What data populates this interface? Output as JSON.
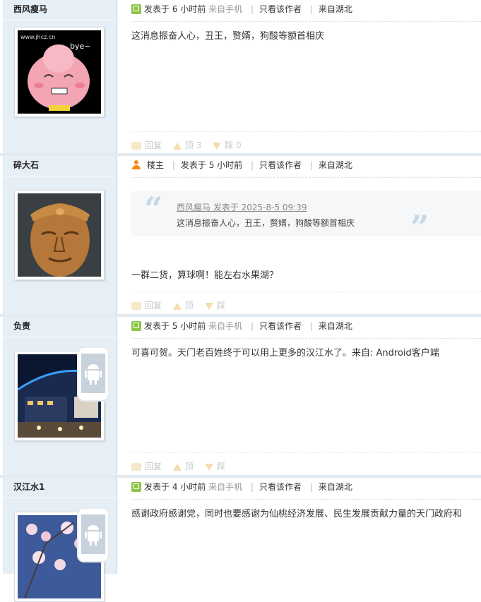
{
  "colors": {
    "side_bg": "#e6eef6",
    "accent_green": "#8ec449",
    "owner_orange": "#f48a0e",
    "muted": "#c9c9c9"
  },
  "posts": [
    {
      "username": "西风瘦马",
      "meta": {
        "posted": "发表于 6 小时前",
        "device": "来自手机",
        "only_author": "只看该作者",
        "location": "来自湖北"
      },
      "body": "这消息振奋人心，丑王，赘婿，狗酸等额首相庆",
      "actions": {
        "reply": "回复",
        "up": "顶 3",
        "down": "踩 0"
      }
    },
    {
      "username": "碎大石",
      "meta": {
        "owner": "楼主",
        "posted": "发表于 5 小时前",
        "only_author": "只看该作者",
        "location": "来自湖北"
      },
      "quote": {
        "source": "西风瘦马 发表于 2025-8-5 09:39",
        "text": "这消息振奋人心，丑王，赘婿，狗酸等额首相庆"
      },
      "body": "一群二货，算球啊！能左右水果湖？",
      "actions": {
        "reply": "回复",
        "up": "顶",
        "down": "踩"
      }
    },
    {
      "username": "负责",
      "meta": {
        "posted": "发表于 5 小时前",
        "device": "来自手机",
        "only_author": "只看该作者",
        "location": "来自湖北"
      },
      "body": "可喜可贺。天门老百姓终于可以用上更多的汉江水了。来自: Android客户端",
      "actions": {
        "reply": "回复",
        "up": "顶",
        "down": "踩"
      }
    },
    {
      "username": "汉江水1",
      "meta": {
        "posted": "发表于 4 小时前",
        "device": "来自手机",
        "only_author": "只看该作者",
        "location": "来自湖北"
      },
      "body": "感谢政府感谢党，同时也要感谢为仙桃经济发展、民生发展贡献力量的天门政府和"
    }
  ]
}
